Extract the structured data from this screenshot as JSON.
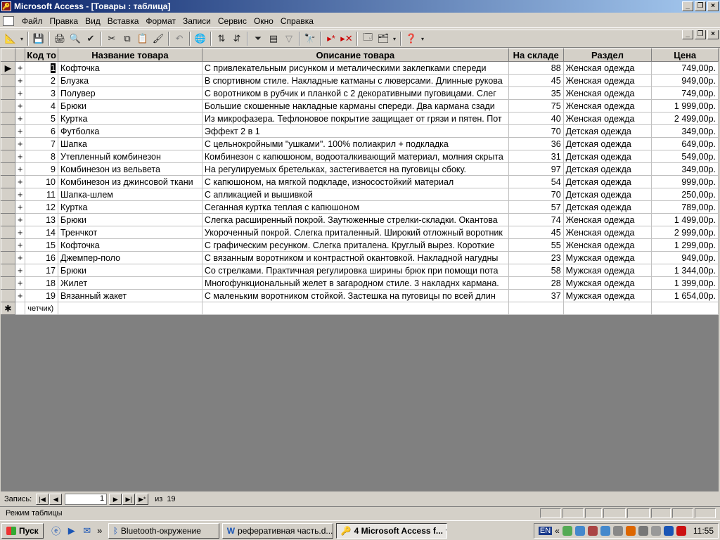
{
  "window": {
    "title": "Microsoft Access - [Товары : таблица]"
  },
  "menu": [
    "Файл",
    "Правка",
    "Вид",
    "Вставка",
    "Формат",
    "Записи",
    "Сервис",
    "Окно",
    "Справка"
  ],
  "table": {
    "columns": [
      "Код то",
      "Название товара",
      "Описание товара",
      "На складе",
      "Раздел",
      "Цена"
    ],
    "rows": [
      [
        "1",
        "Кофточка",
        "С привлекательным рисунком  и металическими заклепками спереди",
        "88",
        "Женская одежда",
        "749,00р."
      ],
      [
        "2",
        "Блузка",
        "В спортивном стиле. Накладные катманы с люверсами. Длинные рукова",
        "45",
        "Женская одежда",
        "949,00р."
      ],
      [
        "3",
        "Полувер",
        "С воротником в рубчик и планкой с 2 декоративными пуговицами. Слег",
        "35",
        "Женская одежда",
        "749,00р."
      ],
      [
        "4",
        "Брюки",
        "Большие скошенные накладные карманы спереди. Два кармана сзади",
        "75",
        "Женская одежда",
        "1 999,00р."
      ],
      [
        "5",
        "Куртка",
        "Из микрофазера. Тефлоновое покрытие защищает от грязи и пятен. Пот",
        "40",
        "Женская одежда",
        "2 499,00р."
      ],
      [
        "6",
        "Футболка",
        "Эффект 2 в 1",
        "70",
        "Детская одежда",
        "349,00р."
      ],
      [
        "7",
        "Шапка",
        "С цельнокройными \"ушками\". 100% полиакрил + подкладка",
        "36",
        "Детская одежда",
        "649,00р."
      ],
      [
        "8",
        "Утепленный комбинезон",
        "Комбинезон с капюшоном, водооталкивающий материал, молния скрыта",
        "31",
        "Детская одежда",
        "549,00р."
      ],
      [
        "9",
        "Комбинезон из вельвета",
        "На регулируемых бретельках, застегивается на пуговицы сбоку.",
        "97",
        "Детская одежда",
        "349,00р."
      ],
      [
        "10",
        "Комбинезон из джинсовой ткани",
        "С капюшоном, на мягкой подкладе,  износостойкий материал",
        "54",
        "Детская одежда",
        "999,00р."
      ],
      [
        "11",
        "Шапка-шлем",
        "С апликацией и вышивкой",
        "70",
        "Детская одежда",
        "250,00р."
      ],
      [
        "12",
        "Куртка",
        "Сеганная куртка теплая с капюшоном",
        "57",
        "Детская одежда",
        "789,00р."
      ],
      [
        "13",
        "Брюки",
        "Слегка расширенный покрой. Заутюженные стрелки-складки. Окантова",
        "74",
        "Женская одежда",
        "1 499,00р."
      ],
      [
        "14",
        "Тренчкот",
        "Укороченный покрой. Слегка приталенный. Широкий отложный воротник",
        "45",
        "Женская одежда",
        "2 999,00р."
      ],
      [
        "15",
        "Кофточка",
        "С графическим ресунком. Слегка приталена. Круглый вырез. Короткие",
        "55",
        "Женская одежда",
        "1 299,00р."
      ],
      [
        "16",
        "Джемпер-поло",
        "С вязанным воротником и контрастной окантовкой. Накладной нагудны",
        "23",
        "Мужская одежда",
        "949,00р."
      ],
      [
        "17",
        "Брюки",
        "Со стрелками. Практичная регулировка ширины брюк при помощи пота",
        "58",
        "Мужская одежда",
        "1 344,00р."
      ],
      [
        "18",
        "Жилет",
        "Многофункциональный желет в загародном стиле. 3 накладнх кармана.",
        "28",
        "Мужская одежда",
        "1 399,00р."
      ],
      [
        "19",
        "Вязанный жакет",
        "С маленьким воротником стойкой. Застешка на пуговицы по всей длин",
        "37",
        "Мужская одежда",
        "1 654,00р."
      ]
    ],
    "new_row_id": "четчик)"
  },
  "nav": {
    "label": "Запись:",
    "current": "1",
    "of_label": "из",
    "total": "19"
  },
  "status": {
    "text": "Режим таблицы"
  },
  "taskbar": {
    "start": "Пуск",
    "tasks": [
      "Bluetooth-окружение",
      "реферативная часть.d...",
      "4 Microsoft Access f..."
    ],
    "lang": "EN",
    "clock": "11:55"
  }
}
